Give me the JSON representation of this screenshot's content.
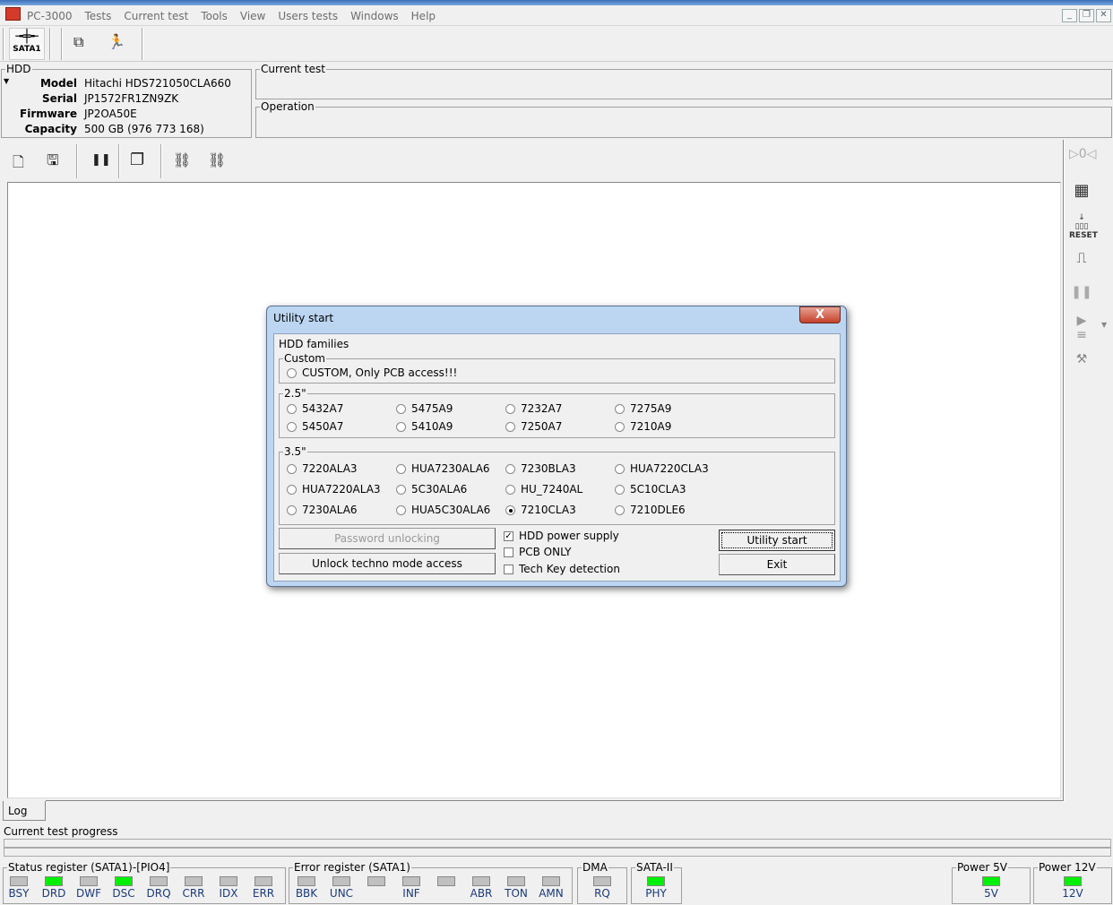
{
  "app": {
    "title": "PC-3000",
    "menu": [
      "Tests",
      "Current test",
      "Tools",
      "View",
      "Users tests",
      "Windows",
      "Help"
    ]
  },
  "toolbar": {
    "port_label": "SATA1"
  },
  "hdd": {
    "legend": "HDD",
    "rows": [
      {
        "k": "Model",
        "v": "Hitachi HDS721050CLA660"
      },
      {
        "k": "Serial",
        "v": "JP1572FR1ZN9ZK"
      },
      {
        "k": "Firmware",
        "v": "JP2OA50E"
      },
      {
        "k": "Capacity",
        "v": "500 GB (976 773 168)"
      }
    ]
  },
  "current_test": {
    "legend": "Current test"
  },
  "operation": {
    "legend": "Operation"
  },
  "right_panel": {
    "reset_label": "RESET"
  },
  "log": {
    "tab": "Log",
    "progress_label": "Current test progress",
    "progress": 0
  },
  "dialog": {
    "title": "Utility start",
    "families_label": "HDD families",
    "custom": {
      "legend": "Custom",
      "option": "CUSTOM, Only PCB access!!!"
    },
    "g25": {
      "legend": "2.5\"",
      "options": [
        [
          "5432A7",
          "5475A9",
          "7232A7",
          "7275A9"
        ],
        [
          "5450A7",
          "5410A9",
          "7250A7",
          "7210A9"
        ]
      ]
    },
    "g35": {
      "legend": "3.5\"",
      "options": [
        [
          "7220ALA3",
          "HUA7230ALA6",
          "7230BLA3",
          "HUA7220CLA3"
        ],
        [
          "HUA7220ALA3",
          "5C30ALA6",
          "HU_7240AL",
          "5C10CLA3"
        ],
        [
          "7230ALA6",
          "HUA5C30ALA6",
          "7210CLA3",
          "7210DLE6"
        ]
      ]
    },
    "selected": "7210CLA3",
    "password_btn": "Password unlocking",
    "unlock_btn": "Unlock techno mode access",
    "checks": [
      {
        "label": "HDD power supply",
        "checked": true
      },
      {
        "label": "PCB ONLY",
        "checked": false
      },
      {
        "label": "Tech Key detection",
        "checked": false
      }
    ],
    "start_btn": "Utility start",
    "exit_btn": "Exit"
  },
  "status": {
    "status_reg": {
      "legend": "Status register (SATA1)-[PIO4]",
      "leds": [
        {
          "l": "BSY",
          "on": false
        },
        {
          "l": "DRD",
          "on": true
        },
        {
          "l": "DWF",
          "on": false
        },
        {
          "l": "DSC",
          "on": true
        },
        {
          "l": "DRQ",
          "on": false
        },
        {
          "l": "CRR",
          "on": false
        },
        {
          "l": "IDX",
          "on": false
        },
        {
          "l": "ERR",
          "on": false
        }
      ]
    },
    "error_reg": {
      "legend": "Error register (SATA1)",
      "leds": [
        {
          "l": "BBK",
          "on": false
        },
        {
          "l": "UNC",
          "on": false
        },
        {
          "l": "",
          "on": false
        },
        {
          "l": "INF",
          "on": false
        },
        {
          "l": "",
          "on": false
        },
        {
          "l": "ABR",
          "on": false
        },
        {
          "l": "TON",
          "on": false
        },
        {
          "l": "AMN",
          "on": false
        }
      ]
    },
    "dma": {
      "legend": "DMA",
      "leds": [
        {
          "l": "RQ",
          "on": false
        }
      ]
    },
    "sata": {
      "legend": "SATA-II",
      "leds": [
        {
          "l": "PHY",
          "on": true
        }
      ]
    },
    "p5": {
      "legend": "Power 5V",
      "leds": [
        {
          "l": "5V",
          "on": true
        }
      ]
    },
    "p12": {
      "legend": "Power 12V",
      "leds": [
        {
          "l": "12V",
          "on": true
        }
      ]
    }
  },
  "colors": {
    "led_on": "#00f000",
    "led_off": "#c0c0c0",
    "led_label": "#1a3a7a"
  }
}
